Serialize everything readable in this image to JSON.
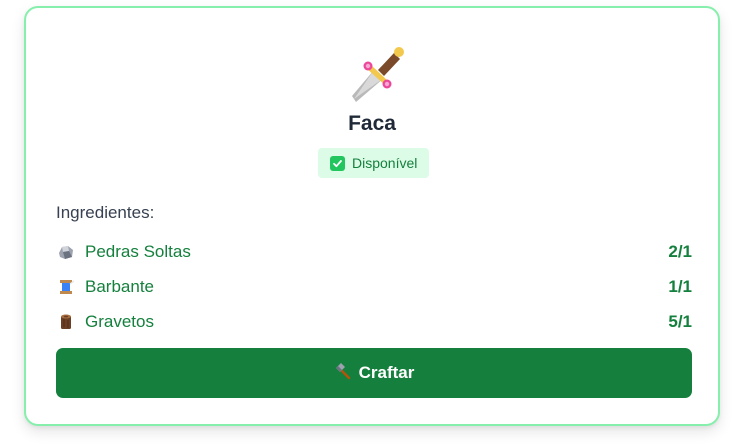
{
  "recipe": {
    "name": "Faca",
    "icon": "dagger-icon",
    "status": {
      "label": "Disponível",
      "icon": "check-icon",
      "color": "#15803d",
      "background": "#dcfce7"
    },
    "ingredients_title": "Ingredientes:",
    "ingredients": [
      {
        "icon": "stone-icon",
        "name": "Pedras Soltas",
        "quantity": "2/1"
      },
      {
        "icon": "thread-spool-icon",
        "name": "Barbante",
        "quantity": "1/1"
      },
      {
        "icon": "wood-log-icon",
        "name": "Gravetos",
        "quantity": "5/1"
      }
    ],
    "craft_button": {
      "label": "Craftar",
      "icon": "hammer-icon",
      "color": "#15803d"
    }
  },
  "colors": {
    "accent": "#15803d",
    "border": "#86efac"
  }
}
